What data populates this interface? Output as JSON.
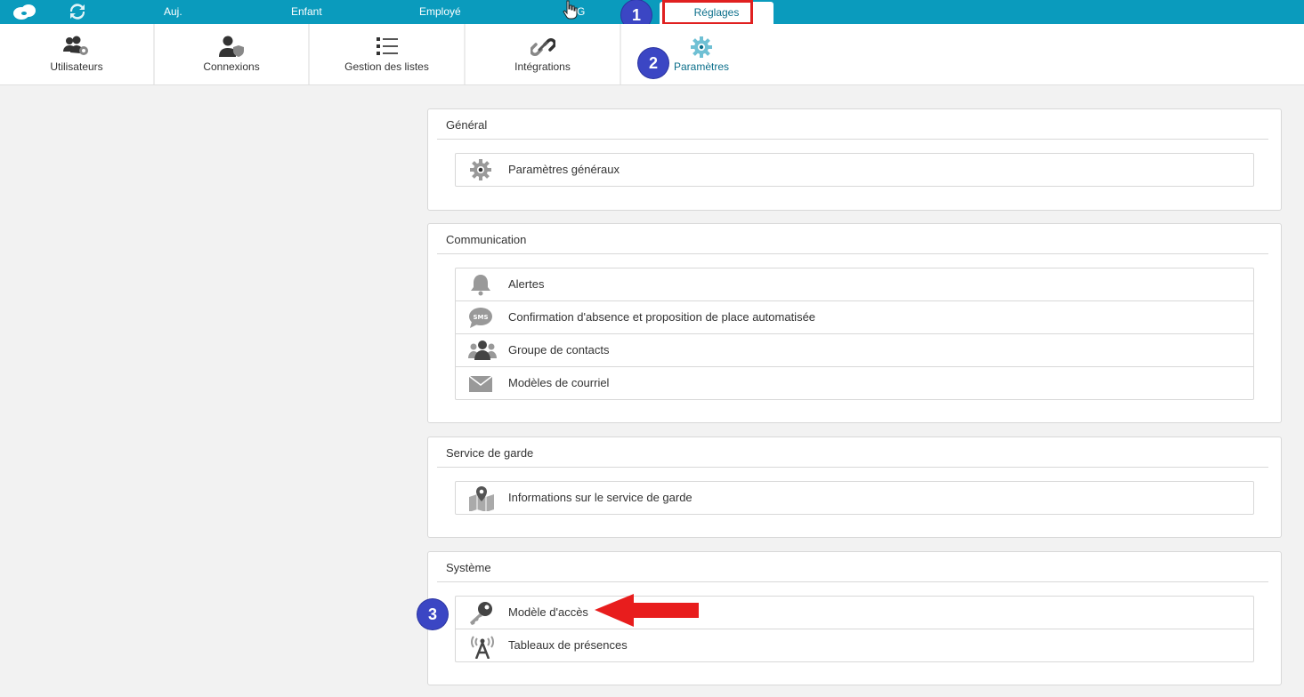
{
  "topnav": {
    "items": [
      "Auj.",
      "Enfant",
      "Employé",
      "G"
    ],
    "active_tab": "Réglages"
  },
  "toolbar": {
    "items": [
      "Utilisateurs",
      "Connexions",
      "Gestion des listes",
      "Intégrations",
      "Paramètres"
    ]
  },
  "badges": [
    "1",
    "2",
    "3"
  ],
  "sections": {
    "general": {
      "title": "Général",
      "items": [
        "Paramètres généraux"
      ]
    },
    "communication": {
      "title": "Communication",
      "items": [
        "Alertes",
        "Confirmation d'absence et proposition de place automatisée",
        "Groupe de contacts",
        "Modèles de courriel"
      ]
    },
    "garde": {
      "title": "Service de garde",
      "items": [
        "Informations sur le service de garde"
      ]
    },
    "systeme": {
      "title": "Système",
      "items": [
        "Modèle d'accès",
        "Tableaux de présences"
      ]
    }
  },
  "colors": {
    "topbar": "#0a9bbd",
    "accent": "#0a6e8a",
    "badge": "#3b46c4",
    "highlight": "#e02020"
  },
  "icons": {
    "topbar": [
      "logo-icon",
      "refresh-icon"
    ],
    "toolbar": [
      "users-gear-icon",
      "user-shield-icon",
      "list-icon",
      "link-icon",
      "gear-icon"
    ],
    "rows": [
      "gear-icon",
      "bell-icon",
      "sms-bubble-icon",
      "group-icon",
      "envelope-icon",
      "map-pin-icon",
      "key-icon",
      "antenna-icon"
    ]
  }
}
